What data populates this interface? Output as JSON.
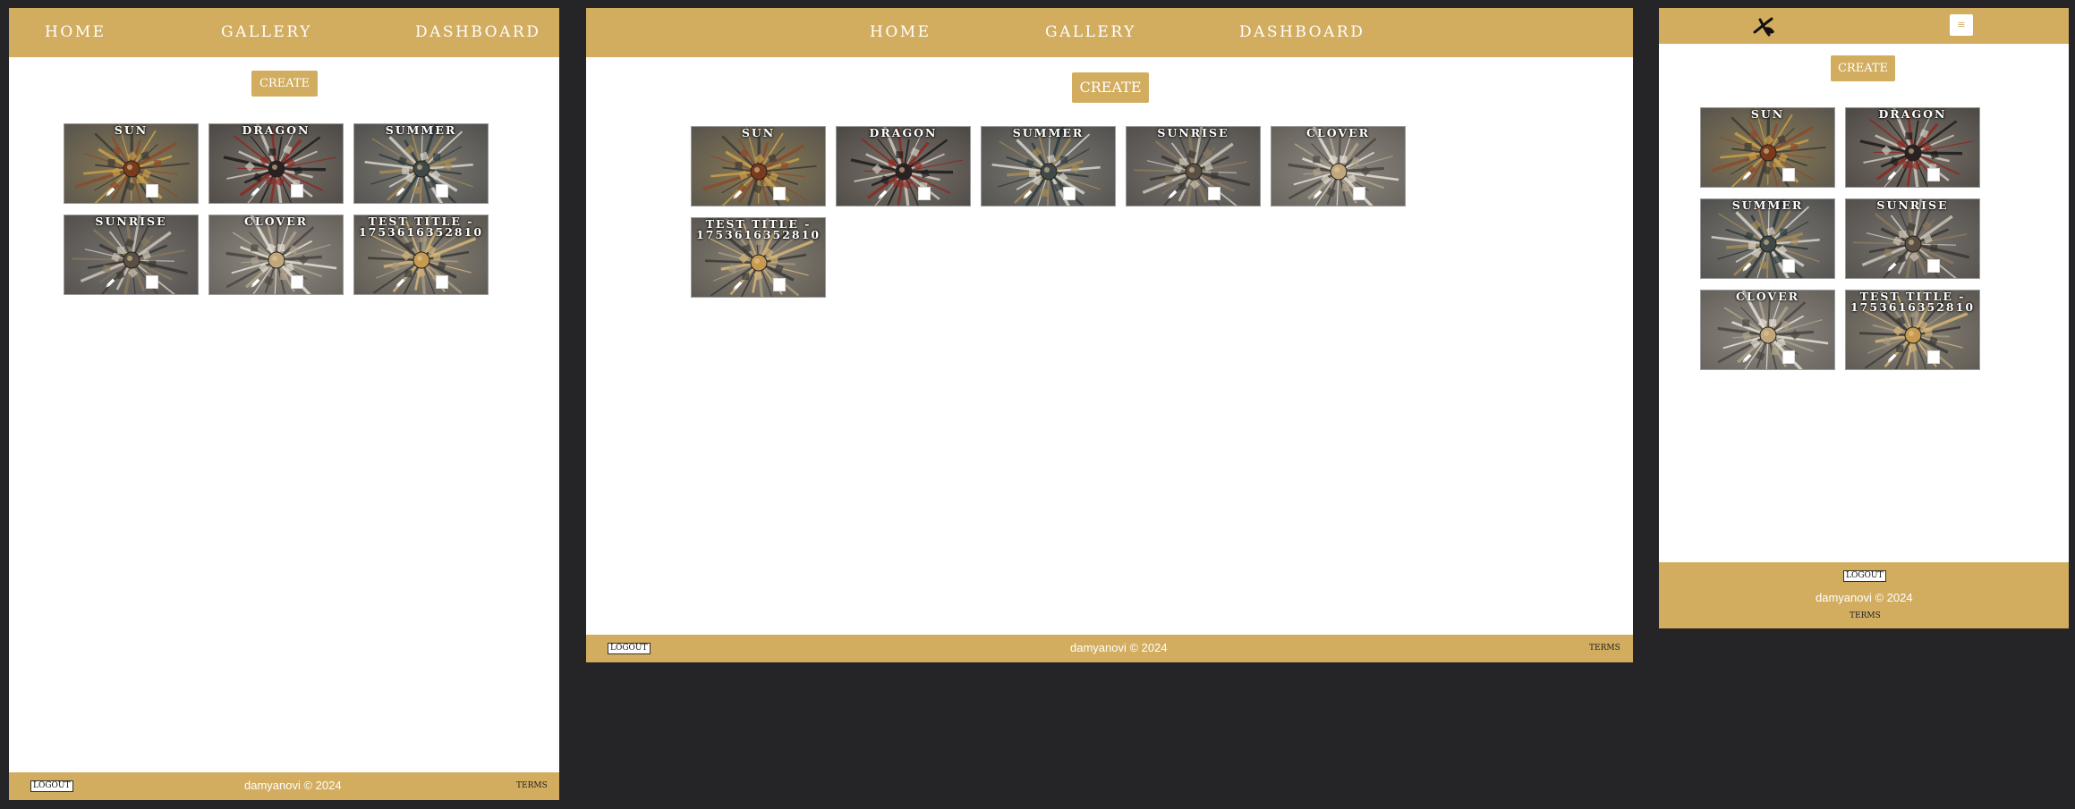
{
  "nav": {
    "home": "Home",
    "gallery": "Gallery",
    "dashboard": "Dashboard"
  },
  "create_label": "Create",
  "cards": [
    {
      "title": "Sun",
      "palette": "sun"
    },
    {
      "title": "Dragon",
      "palette": "dragon"
    },
    {
      "title": "Summer",
      "palette": "summer"
    },
    {
      "title": "Sunrise",
      "palette": "sunrise"
    },
    {
      "title": "Clover",
      "palette": "clover"
    },
    {
      "title": "Test Title - 1753616352810",
      "palette": "test"
    }
  ],
  "footer": {
    "logout": "Logout",
    "copyright": "damyanovi © 2024",
    "terms": "Terms"
  },
  "mobile": {
    "menu_icon": "≡",
    "logo_icon": "brand-logo-icon"
  },
  "colors": {
    "gold": "#d2ad5f",
    "page_bg": "#252527",
    "card_gray": "#6b6a66"
  },
  "icons": {
    "edit": "pencil-icon",
    "delete": "checkbox"
  }
}
